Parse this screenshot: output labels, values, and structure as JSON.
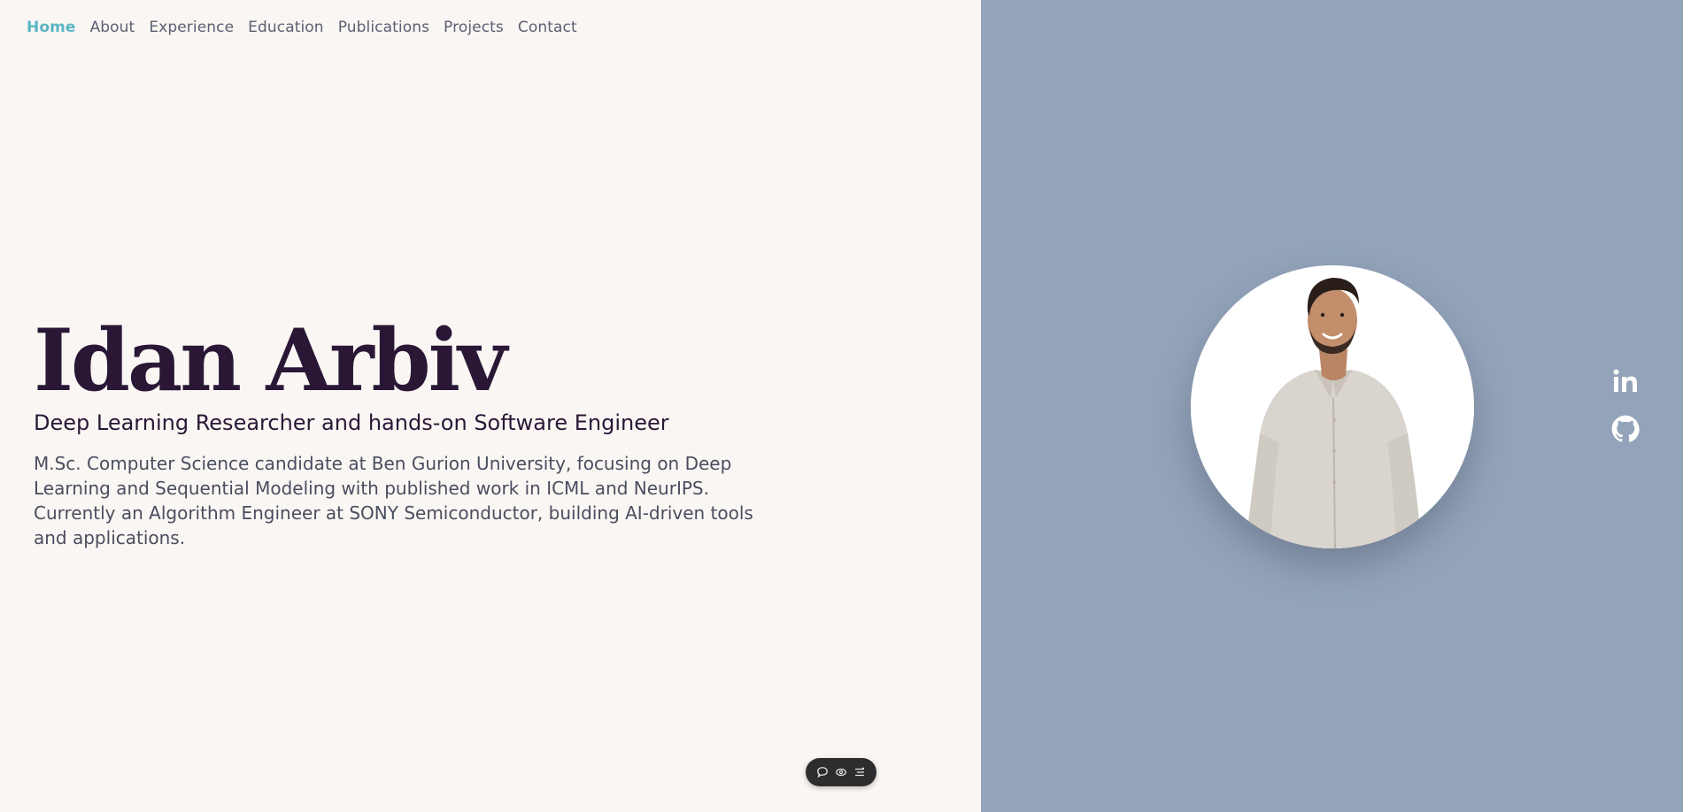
{
  "nav": {
    "items": [
      {
        "label": "Home",
        "active": true
      },
      {
        "label": "About"
      },
      {
        "label": "Experience"
      },
      {
        "label": "Education"
      },
      {
        "label": "Publications"
      },
      {
        "label": "Projects"
      },
      {
        "label": "Contact"
      }
    ]
  },
  "hero": {
    "name": "Idan Arbiv",
    "tagline": "Deep Learning Researcher and hands-on Software Engineer",
    "bio": "M.Sc. Computer Science candidate at Ben Gurion University, focusing on Deep Learning and Sequential Modeling with published work in ICML and NeurIPS. Currently an Algorithm Engineer at SONY Semiconductor, building AI-driven tools and applications."
  },
  "social": {
    "icons": [
      "linkedin-icon",
      "github-icon"
    ]
  },
  "toolbar": {
    "icons": [
      "comment-icon",
      "eye-icon",
      "menu-icon"
    ]
  },
  "colors": {
    "left_bg": "#faf6f3",
    "right_bg": "#93a3b9",
    "accent": "#5bb5c4",
    "heading": "#2a1736"
  }
}
